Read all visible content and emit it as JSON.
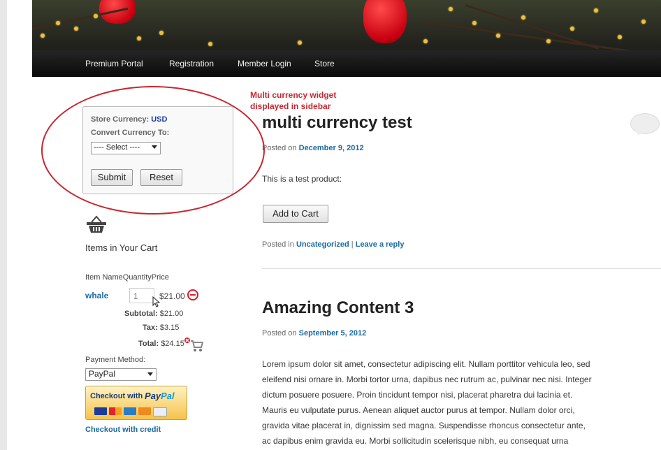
{
  "nav": {
    "items": [
      "Premium Portal",
      "Registration",
      "Member Login",
      "Store"
    ]
  },
  "annotation": {
    "line1": "Multi currency widget",
    "line2": "displayed in sidebar",
    "color": "#c8262f"
  },
  "currency_widget": {
    "store_label": "Store Currency:",
    "store_value": "USD",
    "convert_label": "Convert Currency To:",
    "select_value": "---- Select ----",
    "submit_label": "Submit",
    "reset_label": "Reset"
  },
  "cart": {
    "icon": "basket-icon",
    "title": "Items in Your Cart",
    "headers": {
      "item_name": "Item Name",
      "quantity": "Quantity",
      "price": "Price"
    },
    "item": {
      "name": "whale",
      "quantity": "1",
      "price": "$21.00"
    },
    "subtotal_label": "Subtotal:",
    "subtotal_value": "$21.00",
    "tax_label": "Tax:",
    "tax_value": "$3.15",
    "total_label": "Total:",
    "total_value": "$24.15",
    "payment_label": "Payment Method:",
    "payment_value": "PayPal",
    "paypal_button_text": "Checkout with",
    "paypal_brand_a": "Pay",
    "paypal_brand_b": "Pal",
    "checkout_credit": "Checkout with credit"
  },
  "posts": [
    {
      "title": "multi currency test",
      "posted_prefix": "Posted on",
      "date": "December 9, 2012",
      "body": "This is a test product:",
      "button": "Add to Cart",
      "posted_in_prefix": "Posted in",
      "category": "Uncategorized",
      "separator": "|",
      "reply": "Leave a reply"
    },
    {
      "title": "Amazing Content 3",
      "posted_prefix": "Posted on",
      "date": "September 5, 2012",
      "body_lines": [
        "Lorem ipsum dolor sit amet, consectetur adipiscing elit. Nullam porttitor vehicula leo, sed",
        "eleifend nisi ornare in. Morbi tortor urna, dapibus nec rutrum ac, pulvinar nec nisi. Integer",
        "dictum posuere posuere. Proin tincidunt tempor nisi, placerat pharetra dui lacinia et.",
        "Mauris eu vulputate purus. Aenean aliquet auctor purus at tempor. Nullam dolor orci,",
        "gravida vitae placerat in, dignissim sed magna. Suspendisse rhoncus consectetur ante,",
        "ac dapibus enim gravida eu. Morbi sollicitudin scelerisque nibh, eu consequat urna"
      ]
    }
  ],
  "colors": {
    "link": "#1b6aa3",
    "currency": "#1b3ea8",
    "nav_bg": "#111111"
  }
}
